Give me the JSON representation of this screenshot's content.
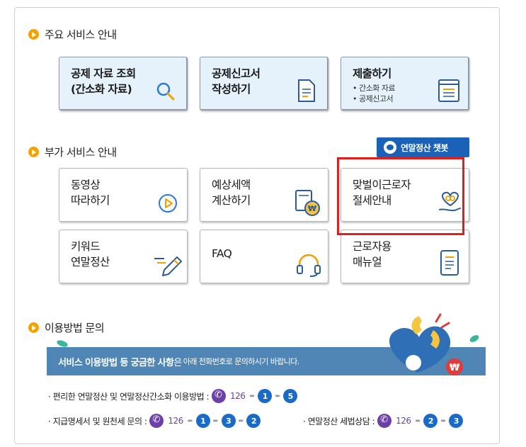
{
  "sections": {
    "main_title": "주요 서비스 안내",
    "extra_title": "부가 서비스 안내",
    "contact_title": "이용방법 문의"
  },
  "main_cards": [
    {
      "line1": "공제 자료 조회",
      "line2": "(간소화 자료)"
    },
    {
      "line1": "공제신고서",
      "line2": "작성하기"
    },
    {
      "line1": "제출하기",
      "sub1": "• 간소화 자료",
      "sub2": "• 공제신고서"
    }
  ],
  "chatbot": {
    "label": "연말정산 챗봇"
  },
  "sub_cards": [
    {
      "line1": "동영상",
      "line2": "따라하기",
      "icon": "play-icon"
    },
    {
      "line1": "예상세액",
      "line2": "계산하기",
      "icon": "calculator-money-icon"
    },
    {
      "line1": "맞벌이근로자",
      "line2": "절세안내",
      "icon": "hand-heart-icon"
    },
    {
      "line1": "키워드",
      "line2": "연말정산",
      "icon": "pencil-icon"
    },
    {
      "line1": "FAQ",
      "line2": "",
      "icon": "headset-icon"
    },
    {
      "line1": "근로자용",
      "line2": "매뉴얼",
      "icon": "manual-icon"
    }
  ],
  "banner": {
    "bold": "서비스 이용방법 등 궁금한 사항",
    "mid": "은",
    "small": "아래 전화번호로 문의하시기 바랍니다."
  },
  "contact": {
    "line1_label": "· 편리한 연말정산 및 연말정산간소화 이용방법 :",
    "line2_label": "· 지급명세서  및 원천세 문의 :",
    "line3_label": "· 연말정산 세법상담  :",
    "phone": "126",
    "seq1": [
      "1",
      "5"
    ],
    "seq2": [
      "1",
      "3",
      "2"
    ],
    "seq3": [
      "2",
      "3"
    ]
  },
  "colors": {
    "accent": "#f5a100",
    "chatbot": "#1a62b8",
    "highlight": "#e21d1d",
    "banner": "#4f86b5",
    "phone": "#6d3fa8"
  }
}
